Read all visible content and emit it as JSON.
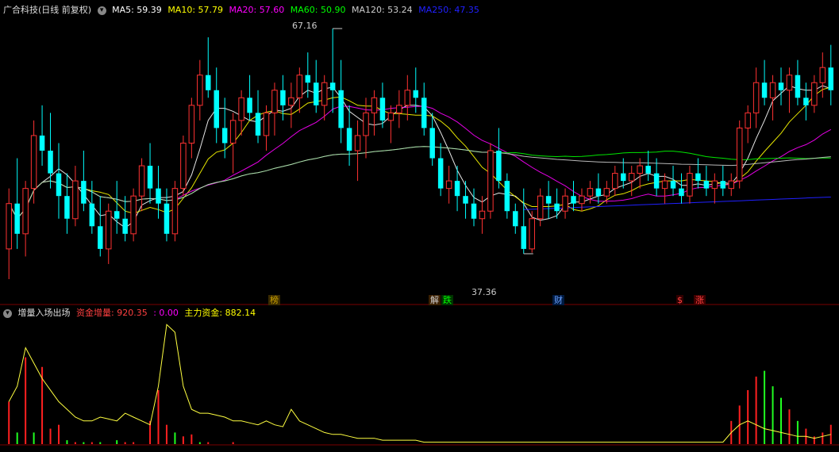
{
  "main_panel": {
    "title": "广合科技(日线 前复权)",
    "ma": [
      {
        "label": "MA5: 59.39",
        "color": "#ffffff"
      },
      {
        "label": "MA10: 57.79",
        "color": "#ffff00"
      },
      {
        "label": "MA20: 57.60",
        "color": "#ff00ff"
      },
      {
        "label": "MA60: 50.90",
        "color": "#00ff00"
      },
      {
        "label": "MA120: 53.24",
        "color": "#cccccc"
      },
      {
        "label": "MA250: 47.35",
        "color": "#2020ff"
      }
    ],
    "high_label": "67.16",
    "low_label": "37.36",
    "event_tags": [
      {
        "text": "榜",
        "color": "#c8a000",
        "bg": "#3a2a00"
      },
      {
        "text": "解",
        "color": "#d0d0d0",
        "bg": "#3a1f00"
      },
      {
        "text": "跌",
        "color": "#00ff00",
        "bg": "#003300"
      },
      {
        "text": "财",
        "color": "#6aa0ff",
        "bg": "#001a40"
      },
      {
        "text": "$",
        "color": "#ff4040",
        "bg": "#300000"
      },
      {
        "text": "涨",
        "color": "#ff4040",
        "bg": "#400000"
      }
    ]
  },
  "sub_panel": {
    "title": "增量入场出场",
    "label1": "资金增量: 920.35",
    "label2": ": 0.00",
    "label3": "主力资金: 882.14",
    "label1_color": "#ff4040",
    "label2_color": "#ff00ff",
    "label3_color": "#ffff00"
  },
  "colors": {
    "up": "#ff3232",
    "down": "#00ffff",
    "bar_up": "#ff2020",
    "bar_down": "#20ff20",
    "main_line": "#ffff40",
    "axis": "#7a0000"
  },
  "chart_data": [
    {
      "type": "candlestick",
      "candles": [
        [
          38,
          46,
          34,
          44
        ],
        [
          44,
          50,
          38,
          40
        ],
        [
          40,
          47,
          37,
          46
        ],
        [
          46,
          55,
          44,
          53
        ],
        [
          53,
          57,
          49,
          51
        ],
        [
          51,
          56,
          46,
          48
        ],
        [
          48,
          52,
          42,
          45
        ],
        [
          45,
          48,
          40,
          42
        ],
        [
          42,
          49,
          41,
          47
        ],
        [
          47,
          51,
          43,
          44
        ],
        [
          44,
          47,
          40,
          41
        ],
        [
          41,
          45,
          37,
          38
        ],
        [
          38,
          44,
          36,
          43
        ],
        [
          43,
          47,
          40,
          42
        ],
        [
          42,
          45,
          39,
          40
        ],
        [
          40,
          46,
          39,
          45
        ],
        [
          45,
          50,
          43,
          49
        ],
        [
          49,
          52,
          44,
          46
        ],
        [
          46,
          49,
          42,
          44
        ],
        [
          44,
          46,
          39,
          40
        ],
        [
          40,
          47,
          39,
          46
        ],
        [
          46,
          53,
          45,
          52
        ],
        [
          52,
          58,
          50,
          57
        ],
        [
          57,
          63,
          55,
          61
        ],
        [
          61,
          66,
          58,
          59
        ],
        [
          59,
          62,
          52,
          54
        ],
        [
          54,
          58,
          50,
          52
        ],
        [
          52,
          56,
          48,
          55
        ],
        [
          55,
          59,
          53,
          58
        ],
        [
          58,
          61,
          55,
          56
        ],
        [
          56,
          59,
          52,
          53
        ],
        [
          53,
          57,
          51,
          56
        ],
        [
          56,
          60,
          53,
          59
        ],
        [
          59,
          61,
          55,
          57
        ],
        [
          57,
          60,
          54,
          58
        ],
        [
          58,
          62,
          56,
          61
        ],
        [
          61,
          64,
          58,
          60
        ],
        [
          60,
          63,
          56,
          57
        ],
        [
          57,
          61,
          55,
          60
        ],
        [
          60,
          67.16,
          56,
          59
        ],
        [
          59,
          63,
          52,
          54
        ],
        [
          54,
          57,
          49,
          51
        ],
        [
          51,
          55,
          47,
          53
        ],
        [
          53,
          58,
          50,
          56
        ],
        [
          56,
          59,
          53,
          58
        ],
        [
          58,
          60,
          54,
          55
        ],
        [
          55,
          57,
          52,
          56
        ],
        [
          56,
          59,
          54,
          57
        ],
        [
          57,
          61,
          55,
          59
        ],
        [
          59,
          62,
          56,
          58
        ],
        [
          58,
          60,
          53,
          54
        ],
        [
          54,
          56,
          49,
          50
        ],
        [
          50,
          52,
          45,
          46
        ],
        [
          46,
          49,
          44,
          47
        ],
        [
          47,
          49,
          43,
          45
        ],
        [
          45,
          47,
          42,
          44
        ],
        [
          44,
          46,
          41,
          42
        ],
        [
          42,
          45,
          40,
          43
        ],
        [
          43,
          52,
          42,
          51
        ],
        [
          51,
          54,
          46,
          47
        ],
        [
          47,
          48,
          42,
          43
        ],
        [
          43,
          44,
          40,
          41
        ],
        [
          41,
          46,
          37.36,
          38
        ],
        [
          38,
          43,
          37.5,
          42
        ],
        [
          42,
          46,
          41,
          45
        ],
        [
          45,
          47,
          42,
          44
        ],
        [
          44,
          46,
          42,
          43
        ],
        [
          43,
          46,
          42,
          45
        ],
        [
          45,
          47,
          43,
          44
        ],
        [
          44,
          46,
          43,
          45
        ],
        [
          45,
          47,
          44,
          46
        ],
        [
          46,
          48,
          44,
          45
        ],
        [
          45,
          47,
          44,
          46
        ],
        [
          46,
          49,
          45,
          48
        ],
        [
          48,
          50,
          46,
          47
        ],
        [
          47,
          49,
          45,
          48
        ],
        [
          48,
          50,
          46,
          49
        ],
        [
          49,
          51,
          47,
          48
        ],
        [
          48,
          50,
          45,
          46
        ],
        [
          46,
          48,
          44,
          47
        ],
        [
          47,
          49,
          45,
          46
        ],
        [
          46,
          48,
          44,
          45
        ],
        [
          45,
          49,
          44,
          48
        ],
        [
          48,
          50,
          46,
          47
        ],
        [
          47,
          49,
          45,
          46
        ],
        [
          46,
          48,
          44,
          47
        ],
        [
          47,
          49,
          45,
          46
        ],
        [
          46,
          48,
          45,
          47
        ],
        [
          47,
          55,
          46,
          54
        ],
        [
          54,
          57,
          52,
          56
        ],
        [
          56,
          62,
          54,
          60
        ],
        [
          60,
          63,
          57,
          58
        ],
        [
          58,
          61,
          55,
          60
        ],
        [
          60,
          62,
          57,
          59
        ],
        [
          59,
          62,
          56,
          61
        ],
        [
          61,
          63,
          57,
          58
        ],
        [
          58,
          60,
          55,
          57
        ],
        [
          57,
          61,
          56,
          60
        ],
        [
          60,
          64,
          58,
          62
        ],
        [
          62,
          65,
          57,
          59
        ]
      ],
      "ma_series": [
        "MA5",
        "MA10",
        "MA20",
        "MA60",
        "MA120",
        "MA250"
      ]
    },
    {
      "type": "bar",
      "bars": [
        [
          22,
          "up"
        ],
        [
          6,
          "down"
        ],
        [
          45,
          "up"
        ],
        [
          6,
          "down"
        ],
        [
          40,
          "up"
        ],
        [
          8,
          "up"
        ],
        [
          10,
          "up"
        ],
        [
          2,
          "down"
        ],
        [
          1,
          "up"
        ],
        [
          1,
          "down"
        ],
        [
          1,
          "up"
        ],
        [
          1,
          "down"
        ],
        [
          0,
          "up"
        ],
        [
          2,
          "down"
        ],
        [
          1,
          "up"
        ],
        [
          1,
          "up"
        ],
        [
          0,
          "down"
        ],
        [
          12,
          "up"
        ],
        [
          28,
          "up"
        ],
        [
          10,
          "up"
        ],
        [
          6,
          "down"
        ],
        [
          4,
          "up"
        ],
        [
          5,
          "up"
        ],
        [
          1,
          "down"
        ],
        [
          1,
          "up"
        ],
        [
          0,
          "up"
        ],
        [
          0,
          "down"
        ],
        [
          1,
          "up"
        ],
        [
          0,
          "down"
        ],
        [
          0,
          "up"
        ],
        [
          0,
          "up"
        ],
        [
          0,
          "down"
        ],
        [
          0,
          "up"
        ],
        [
          0,
          "up"
        ],
        [
          0,
          "down"
        ],
        [
          0,
          "up"
        ],
        [
          0,
          "up"
        ],
        [
          0,
          "down"
        ],
        [
          0,
          "up"
        ],
        [
          0,
          "up"
        ],
        [
          0,
          "up"
        ],
        [
          0,
          "down"
        ],
        [
          0,
          "up"
        ],
        [
          0,
          "up"
        ],
        [
          0,
          "down"
        ],
        [
          0,
          "up"
        ],
        [
          0,
          "up"
        ],
        [
          0,
          "down"
        ],
        [
          0,
          "up"
        ],
        [
          0,
          "up"
        ],
        [
          0,
          "up"
        ],
        [
          0,
          "up"
        ],
        [
          0,
          "down"
        ],
        [
          0,
          "up"
        ],
        [
          0,
          "up"
        ],
        [
          0,
          "down"
        ],
        [
          0,
          "up"
        ],
        [
          0,
          "up"
        ],
        [
          0,
          "down"
        ],
        [
          0,
          "up"
        ],
        [
          0,
          "up"
        ],
        [
          0,
          "up"
        ],
        [
          0,
          "down"
        ],
        [
          0,
          "up"
        ],
        [
          0,
          "up"
        ],
        [
          0,
          "down"
        ],
        [
          0,
          "up"
        ],
        [
          0,
          "up"
        ],
        [
          0,
          "down"
        ],
        [
          0,
          "up"
        ],
        [
          0,
          "up"
        ],
        [
          0,
          "up"
        ],
        [
          0,
          "down"
        ],
        [
          0,
          "up"
        ],
        [
          0,
          "up"
        ],
        [
          0,
          "down"
        ],
        [
          0,
          "up"
        ],
        [
          0,
          "up"
        ],
        [
          0,
          "down"
        ],
        [
          0,
          "up"
        ],
        [
          0,
          "up"
        ],
        [
          0,
          "up"
        ],
        [
          0,
          "down"
        ],
        [
          0,
          "up"
        ],
        [
          0,
          "up"
        ],
        [
          0,
          "down"
        ],
        [
          0,
          "up"
        ],
        [
          12,
          "up"
        ],
        [
          20,
          "up"
        ],
        [
          28,
          "up"
        ],
        [
          35,
          "up"
        ],
        [
          38,
          "down"
        ],
        [
          30,
          "down"
        ],
        [
          24,
          "down"
        ],
        [
          18,
          "up"
        ],
        [
          12,
          "down"
        ],
        [
          8,
          "up"
        ],
        [
          4,
          "up"
        ],
        [
          6,
          "up"
        ],
        [
          10,
          "up"
        ]
      ],
      "line": [
        22,
        30,
        50,
        42,
        34,
        28,
        22,
        18,
        14,
        12,
        12,
        14,
        13,
        12,
        16,
        14,
        12,
        10,
        30,
        62,
        58,
        30,
        18,
        16,
        16,
        15,
        14,
        12,
        12,
        11,
        10,
        12,
        10,
        9,
        18,
        12,
        10,
        8,
        6,
        5,
        5,
        4,
        3,
        3,
        3,
        2,
        2,
        2,
        2,
        2,
        1,
        1,
        1,
        1,
        1,
        1,
        1,
        1,
        1,
        1,
        1,
        1,
        1,
        1,
        1,
        1,
        1,
        1,
        1,
        1,
        1,
        1,
        1,
        1,
        1,
        1,
        1,
        1,
        1,
        1,
        1,
        1,
        1,
        1,
        1,
        1,
        1,
        6,
        10,
        12,
        10,
        8,
        7,
        6,
        5,
        4,
        4,
        3,
        4,
        5
      ]
    }
  ]
}
